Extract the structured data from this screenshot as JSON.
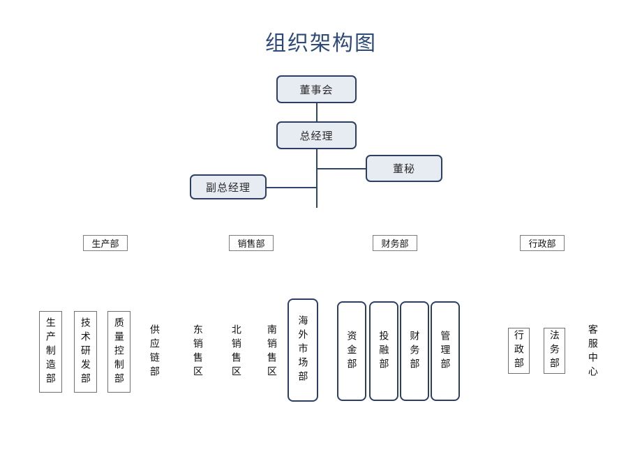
{
  "document": {
    "title": "组织架构图"
  },
  "colors": {
    "title": "#2e4a78",
    "node_border": "#2c3f63",
    "node_fill": "#e7ebf2",
    "line": "#30456b",
    "chip_border": "#7c7c7c",
    "text": "#111111"
  },
  "hierarchy": {
    "board": {
      "label": "董事会"
    },
    "general_manager": {
      "label": "总经理"
    },
    "board_secretary": {
      "label": "董秘"
    },
    "deputy_general_manager": {
      "label": "副总经理"
    }
  },
  "departments": [
    {
      "id": "production",
      "label": "生产部"
    },
    {
      "id": "sales",
      "label": "销售部"
    },
    {
      "id": "finance",
      "label": "财务部"
    },
    {
      "id": "administration",
      "label": "行政部"
    }
  ],
  "units": {
    "production": [
      {
        "label": "生产制造部",
        "style": "thin"
      },
      {
        "label": "技术研发部",
        "style": "thin"
      },
      {
        "label": "质量控制部",
        "style": "thin"
      },
      {
        "label": "供应链部",
        "style": "bare"
      }
    ],
    "sales": [
      {
        "label": "东销售区",
        "style": "bare"
      },
      {
        "label": "北销售区",
        "style": "bare"
      },
      {
        "label": "南销售区",
        "style": "bare"
      },
      {
        "label": "海外市场部",
        "style": "navy"
      }
    ],
    "finance": [
      {
        "label": "资金部",
        "style": "navy"
      },
      {
        "label": "投融部",
        "style": "navy"
      },
      {
        "label": "财务部",
        "style": "navy"
      },
      {
        "label": "管理部",
        "style": "navy"
      }
    ],
    "administration": [
      {
        "label": "行政部",
        "style": "thin"
      },
      {
        "label": "法务部",
        "style": "thin"
      },
      {
        "label": "客服中心",
        "style": "bare"
      }
    ]
  }
}
